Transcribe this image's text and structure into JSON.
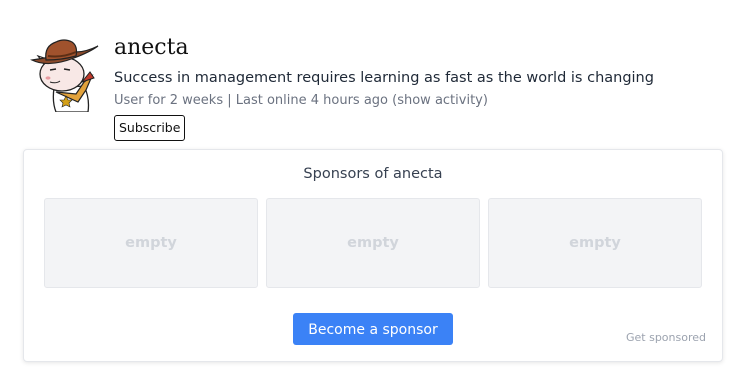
{
  "profile": {
    "username": "anecta",
    "bio": "Success in management requires learning as fast as the world is changing",
    "meta_prefix": "User for 2 weeks | Last online 4 hours ago ",
    "show_activity": "(show activity)",
    "subscribe_label": "Subscribe",
    "avatar_icon": "cowboy-cat-avatar"
  },
  "sponsors": {
    "title": "Sponsors of anecta",
    "slots": [
      "empty",
      "empty",
      "empty"
    ],
    "become_label": "Become a sponsor",
    "get_sponsored_label": "Get sponsored"
  },
  "colors": {
    "accent": "#3b82f6",
    "slot_bg": "#f3f4f6",
    "muted_text": "#6b7280"
  }
}
